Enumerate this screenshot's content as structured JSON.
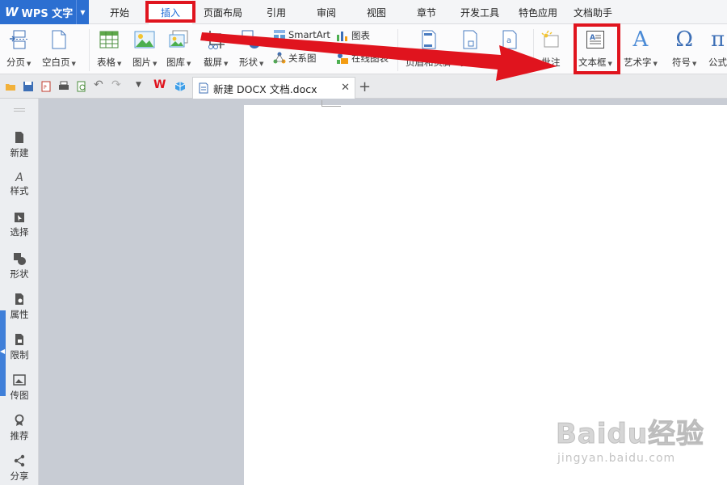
{
  "app": {
    "name": "WPS 文字"
  },
  "menu": {
    "tabs": [
      {
        "label": "开始"
      },
      {
        "label": "插入"
      },
      {
        "label": "页面布局"
      },
      {
        "label": "引用"
      },
      {
        "label": "审阅"
      },
      {
        "label": "视图"
      },
      {
        "label": "章节"
      },
      {
        "label": "开发工具"
      },
      {
        "label": "特色应用"
      },
      {
        "label": "文档助手"
      }
    ],
    "active_tab": "插入"
  },
  "ribbon": {
    "page_break": "分页",
    "blank_page": "空白页",
    "table": "表格",
    "picture": "图片",
    "gallery": "图库",
    "screenshot": "截屏",
    "shape": "形状",
    "smartart": "SmartArt",
    "chart": "图表",
    "relation_chart": "关系图",
    "online_chart": "在线图表",
    "header_footer": "页眉和页脚",
    "page_number": "页码",
    "watermark": "水印",
    "comment": "批注",
    "textbox": "文本框",
    "wordart": "艺术字",
    "symbol": "符号",
    "formula": "公式"
  },
  "document": {
    "tab_title": "新建 DOCX 文档.docx"
  },
  "sidebar": {
    "items": [
      {
        "label": "新建"
      },
      {
        "label": "样式"
      },
      {
        "label": "选择"
      },
      {
        "label": "形状"
      },
      {
        "label": "属性"
      },
      {
        "label": "限制"
      },
      {
        "label": "传图"
      },
      {
        "label": "推荐"
      },
      {
        "label": "分享"
      }
    ]
  },
  "watermark_overlay": {
    "brand": "Baidu经验",
    "url": "jingyan.baidu.com"
  },
  "colors": {
    "accent": "#2c6fd1",
    "highlight": "#e0141e",
    "workspace": "#c8ccd4"
  }
}
